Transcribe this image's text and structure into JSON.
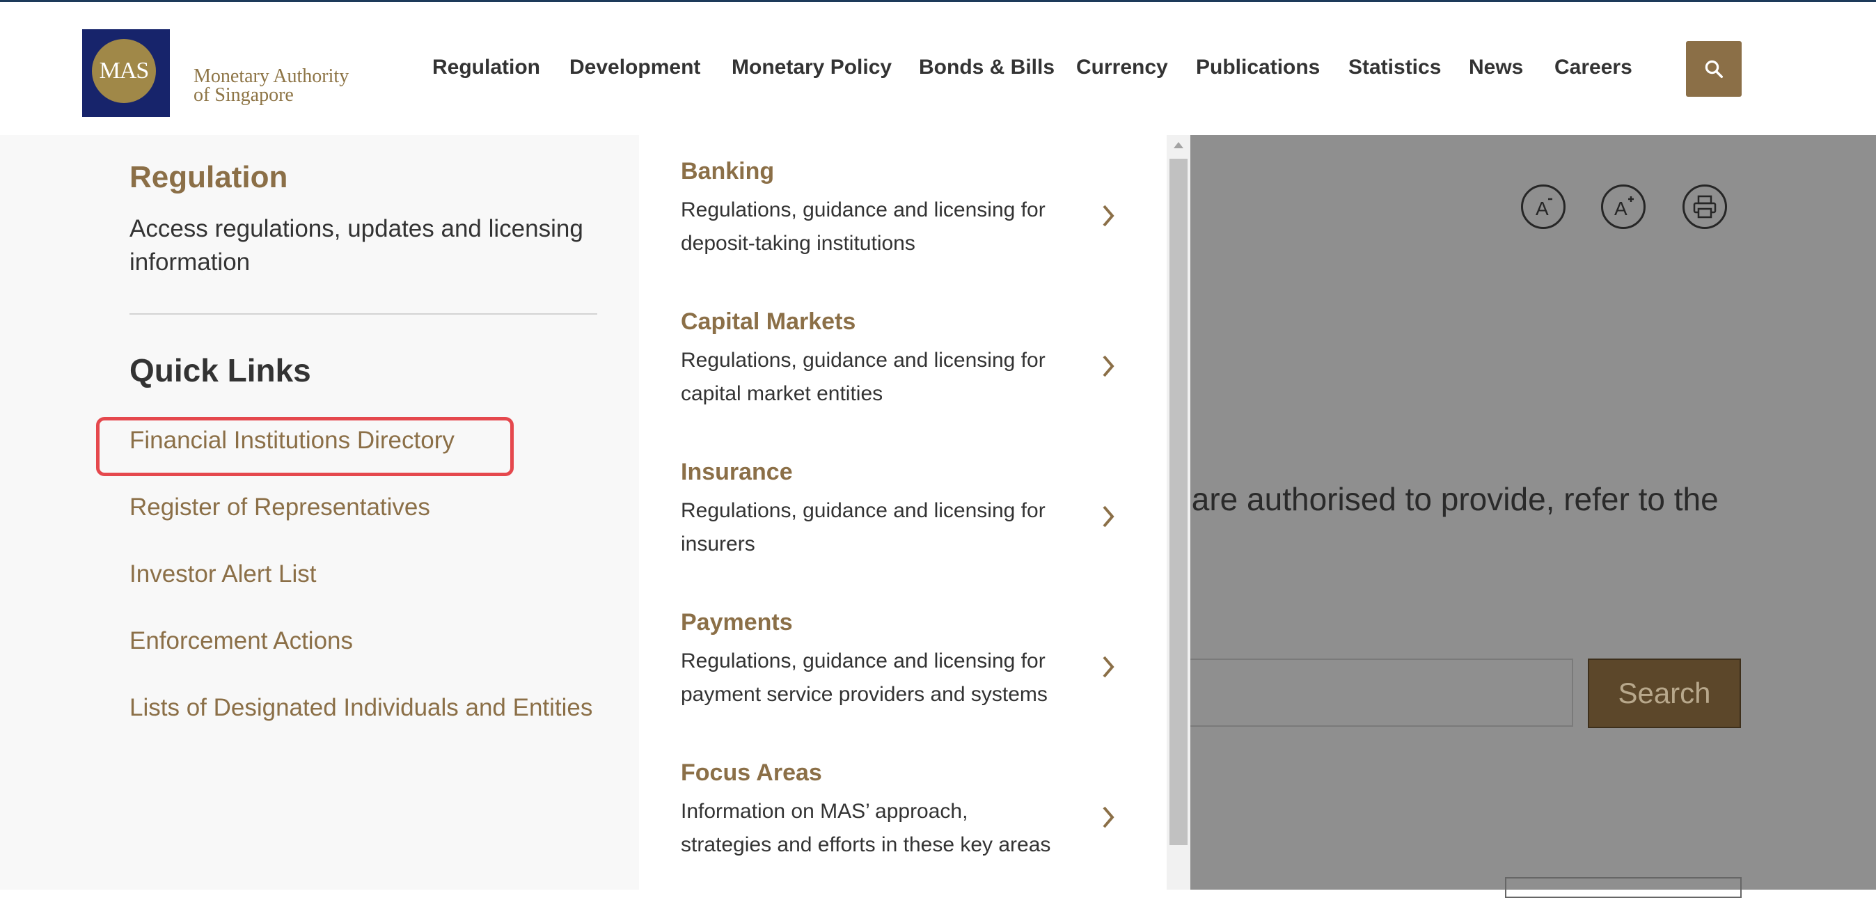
{
  "logo": {
    "emblem_text": "MAS",
    "name_line1": "Monetary Authority",
    "name_line2": "of Singapore"
  },
  "nav": {
    "items": [
      "Regulation",
      "Development",
      "Monetary Policy",
      "Bonds & Bills",
      "Currency",
      "Publications",
      "Statistics",
      "News",
      "Careers"
    ]
  },
  "background": {
    "partial_text": "y are authorised to provide, refer to the",
    "search_label": "Search"
  },
  "dropdown": {
    "title": "Regulation",
    "description": "Access regulations, updates and licensing information",
    "quick_links_title": "Quick Links",
    "quick_links": [
      "Financial Institutions Directory",
      "Register of Representatives",
      "Investor Alert List",
      "Enforcement Actions",
      "Lists of Designated Individuals and Entities"
    ],
    "sections": [
      {
        "title": "Banking",
        "line1": "Regulations, guidance and licensing for",
        "line2": "deposit-taking institutions"
      },
      {
        "title": "Capital Markets",
        "line1": "Regulations, guidance and licensing for",
        "line2": "capital market entities"
      },
      {
        "title": "Insurance",
        "line1": "Regulations, guidance and licensing for",
        "line2": "insurers"
      },
      {
        "title": "Payments",
        "line1": "Regulations, guidance and licensing for",
        "line2": "payment service providers and systems"
      },
      {
        "title": "Focus Areas",
        "line1": "Information on MAS’ approach,",
        "line2": "strategies and efforts in these key areas"
      }
    ]
  },
  "icons": {
    "search": "search-icon",
    "decrease_font": "font-decrease-icon",
    "increase_font": "font-increase-icon",
    "print": "print-icon",
    "chevron": "chevron-right-icon"
  },
  "colors": {
    "brand_gold": "#8b6f47",
    "logo_navy": "#17246b",
    "highlight_red": "#e5484d"
  }
}
